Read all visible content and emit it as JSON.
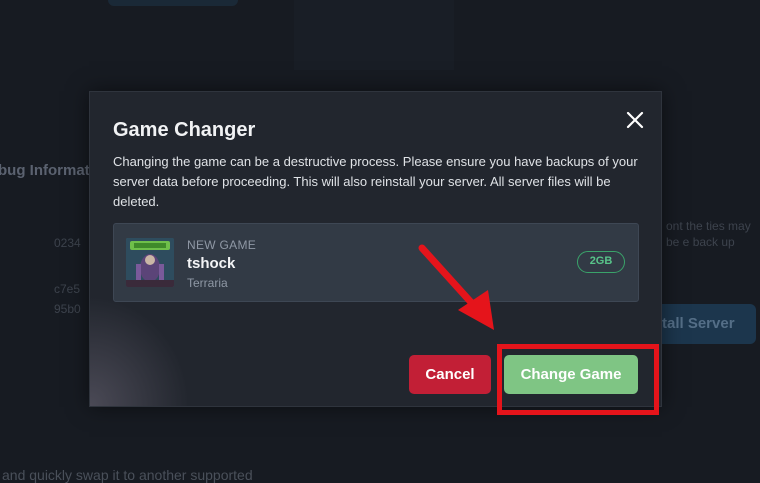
{
  "background": {
    "heading": "bug Informat",
    "num1": "0234",
    "num2": "c7e5",
    "num3": "95b0",
    "right_text": "ont the ties may be e back up",
    "install_label": "tall Server",
    "bottom_text": "and quickly swap it to another supported"
  },
  "modal": {
    "title": "Game Changer",
    "close_icon": "close-icon",
    "description": "Changing the game can be a destructive process. Please ensure you have backups of your server data before proceeding. This will also reinstall your server. All server files will be deleted.",
    "game": {
      "eyebrow": "NEW GAME",
      "name": "tshock",
      "subtitle": "Terraria",
      "size": "2GB",
      "thumbnail_icon": "terraria-game-art"
    },
    "cancel_label": "Cancel",
    "confirm_label": "Change Game"
  },
  "colors": {
    "cancel": "#c21f36",
    "confirm": "#7fc584",
    "badge": "#3aa36a",
    "annotation": "#e5141b"
  }
}
